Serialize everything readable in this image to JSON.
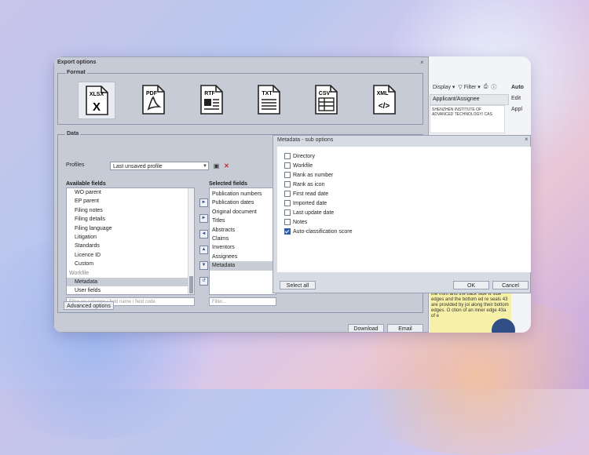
{
  "colors": {
    "dialog_bg": "#c6cbd6",
    "accent": "#2f5fa8",
    "background_accent": "#2f4f86",
    "note_bg": "#f7f0a8"
  },
  "export_dialog": {
    "title": "Export options",
    "close_glyph": "×",
    "format_group_label": "Format",
    "formats": [
      {
        "label": "XLSX",
        "glyph": "X",
        "icon": "xlsx-file-icon"
      },
      {
        "label": "PDF",
        "glyph": "",
        "icon": "pdf-file-icon"
      },
      {
        "label": "RTF",
        "glyph": "",
        "icon": "rtf-file-icon"
      },
      {
        "label": "TXT",
        "glyph": "",
        "icon": "txt-file-icon"
      },
      {
        "label": "CSV",
        "glyph": "",
        "icon": "csv-file-icon"
      },
      {
        "label": "XML",
        "glyph": "</>",
        "icon": "xml-file-icon"
      }
    ],
    "data_group_label": "Data",
    "profiles_label": "Profiles",
    "profile_value": "Last unsaved profile",
    "available_fields_header": "Available fields",
    "available_fields": [
      "WO parent",
      "EP parent",
      "Filing notes",
      "Filing details",
      "Filing language",
      "Litigation",
      "Standards",
      "Licence ID",
      "Custom"
    ],
    "available_category": "Workfile",
    "available_sub_fields": [
      "Metadata",
      "User fields"
    ],
    "available_filter_placeholder": "Filter on category / field name / field code",
    "selected_fields_header": "Selected fields",
    "selected_fields": [
      "Publication numbers",
      "Publication dates",
      "Original document",
      "Titles",
      "Abstracts",
      "Claims",
      "Inventors",
      "Assignees",
      "Metadata"
    ],
    "selected_filter_placeholder": "Filter...",
    "advanced_button": "Advanced options",
    "download_button": "Download",
    "email_button": "Email"
  },
  "metadata_dialog": {
    "title": "Metadata - sub options",
    "close_glyph": "×",
    "options": [
      {
        "label": "Directory",
        "checked": false
      },
      {
        "label": "Workfile",
        "checked": false
      },
      {
        "label": "Rank as number",
        "checked": false
      },
      {
        "label": "Rank as icon",
        "checked": false
      },
      {
        "label": "First read date",
        "checked": false
      },
      {
        "label": "Imported date",
        "checked": false
      },
      {
        "label": "Last update date",
        "checked": false
      },
      {
        "label": "Notes",
        "checked": false
      },
      {
        "label": "Auto-classification score",
        "checked": true
      }
    ],
    "select_all_button": "Select all",
    "ok_button": "OK",
    "cancel_button": "Cancel"
  },
  "background_app": {
    "display_label": "Display",
    "filter_label": "Filter",
    "column_header": "Applicant/Assignee",
    "cell_text": "SHENZHEN INSTITUTE OF ADVANCED TECHNOLOGY/ CAS",
    "right_col_header": "Auto",
    "right_col_items": [
      "Edit",
      "Appl"
    ],
    "note_text": "the front and the back side w side edges and the bottom ed re seals 43 are provided by joi along their bottom edges. O ction of an inner edge 43a of e"
  }
}
